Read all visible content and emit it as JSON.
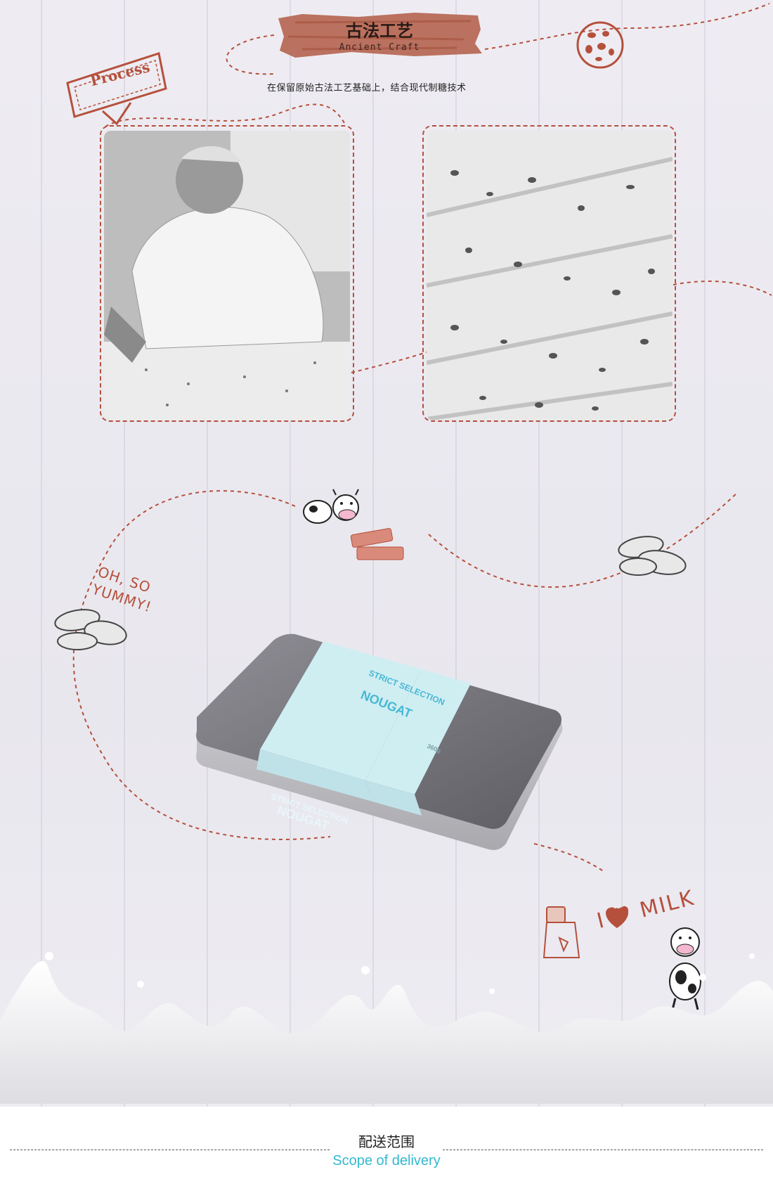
{
  "header": {
    "title_cn": "古法工艺",
    "title_en": "Ancient Craft",
    "tagline": "在保留原始古法工艺基础上，结合现代制糖技术",
    "stamp_label": "Process"
  },
  "photos": [
    {
      "name": "chef-making-nougat-photo"
    },
    {
      "name": "nougat-closeup-photo"
    }
  ],
  "decorations": {
    "yummy_text": "OH, SO YUMMY!",
    "milk_text": "I ♥ MILK"
  },
  "product": {
    "band_title": "STRICT SELECTION",
    "band_product": "NOUGAT",
    "band_weight": "360g"
  },
  "footer": {
    "title_cn": "配送范围",
    "title_en": "Scope of delivery"
  },
  "colors": {
    "accent": "#b5503c",
    "footer_sub": "#33b9d0",
    "band": "#cfeef2"
  }
}
